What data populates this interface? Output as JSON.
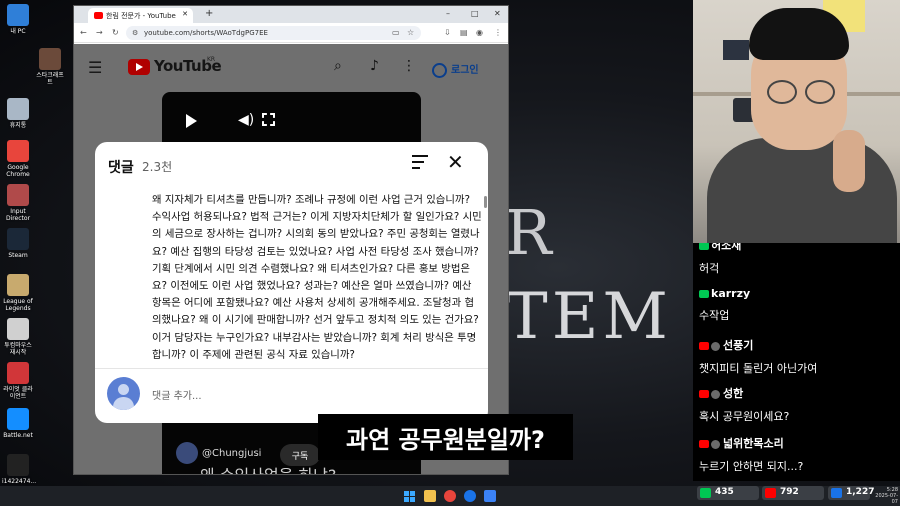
{
  "desktop": {
    "icons": [
      {
        "label": "내 PC",
        "color": "#2f7fd8"
      },
      {
        "label": "스타크래프트",
        "color": "#6b4a3a"
      },
      {
        "label": "휴지통",
        "color": "#a9b7c6"
      },
      {
        "label": "Google Chrome",
        "color": "#e8453c"
      },
      {
        "label": "Input Director",
        "color": "#b04a4a"
      },
      {
        "label": "Steam",
        "color": "#1b2838"
      },
      {
        "label": "League of Legends",
        "color": "#c8aa6e"
      },
      {
        "label": "투컴마우스 재시작",
        "color": "#d0d0d0"
      },
      {
        "label": "라이엇 클라이언트",
        "color": "#d13639"
      },
      {
        "label": "Battle.net",
        "color": "#148eff"
      },
      {
        "label": "i1422474...",
        "color": "#222222"
      }
    ]
  },
  "browser": {
    "tab_title": "한림 전문가 - YouTube",
    "new_tab": "+",
    "url": "youtube.com/shorts/WAoTdgPG7EE",
    "win_minimize": "–",
    "win_maximize": "□",
    "win_close": "✕"
  },
  "youtube": {
    "logo_text": "YouTube",
    "logo_region": "KR",
    "login_label": "로그인",
    "channel_name": "@Chungjusi",
    "subscribe_label": "구독",
    "video_caption": "왜 수익사업을 하냐?"
  },
  "comments": {
    "title": "댓글",
    "count": "2.3천",
    "close_icon": "✕",
    "body": "왜 지자체가 티셔츠를 만듭니까? 조례나 규정에 이런 사업 근거 있습니까? 수익사업 허용되나요? 법적 근거는? 이게 지방자치단체가 할 일인가요? 시민의 세금으로 장사하는 겁니까? 시의회 동의 받았나요? 주민 공청회는 열렸나요? 예산 집행의 타당성 검토는 있었나요? 사업 사전 타당성 조사 했습니까? 기획 단계에서 시민 의견 수렴했나요? 왜 티셔츠인가요? 다른 홍보 방법은요? 이전에도 이런 사업 했었나요? 성과는? 예산은 얼마 쓰였습니까? 예산 항목은 어디에 포함됐나요? 예산 사용처 상세히 공개해주세요. 조달청과 협의했나요? 왜 이 시기에 판매합니까? 선거 앞두고 정치적 의도 있는 건가요? 이거 담당자는 누구인가요? 내부감사는 받았습니까? 회계 처리 방식은 투명합니까? 이 주제에 관련된 공식 자료 있습니까?",
    "add_placeholder": "댓글 추가..."
  },
  "subtitle": "과연 공무원분일까?",
  "background_text": {
    "line1": "R",
    "line2": "TEM"
  },
  "chat": {
    "messages": [
      {
        "user": "허소새",
        "text": "허걱",
        "platform": "chzzk"
      },
      {
        "user": "karrzy",
        "text": "수작업",
        "platform": "chzzk"
      },
      {
        "user": "선풍기",
        "text": "챗지피티 돌린거 아닌가여",
        "platform": "youtube"
      },
      {
        "user": "성한",
        "text": "혹시 공무원이세요?",
        "platform": "youtube"
      },
      {
        "user": "넓위한목소리",
        "text": "누르기 안하면 되지...?",
        "platform": "youtube"
      }
    ]
  },
  "stats": {
    "chzzk_viewers": "435",
    "youtube_viewers": "792",
    "other_viewers": "1,227"
  },
  "clock": {
    "time": "5:28",
    "date": "2025-07-07"
  },
  "colors": {
    "youtube_red": "#ff0000",
    "chzzk_green": "#00c853",
    "link_blue": "#0a3e8c"
  }
}
